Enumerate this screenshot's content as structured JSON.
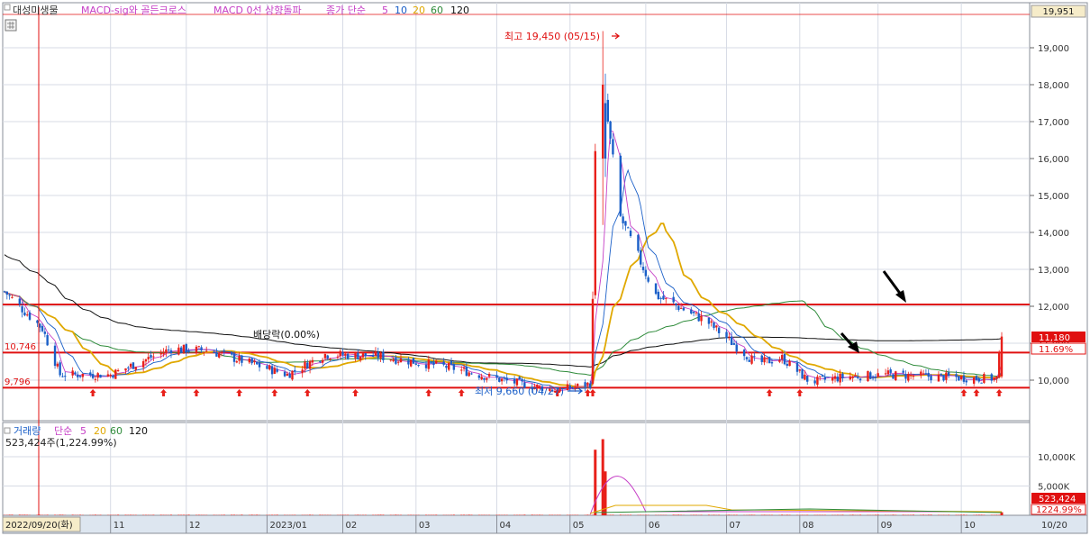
{
  "colors": {
    "up": "#e8201a",
    "down": "#1a5fc8",
    "ma5": "#c63fc6",
    "ma20": "#e0a800",
    "ma60": "#2e8b3a",
    "ma120": "#111111",
    "level": "#e01010",
    "grid": "#d7dbe5",
    "axis_bg": "#dde6f0"
  },
  "price_panel": {
    "legend": {
      "name": "대성미생물",
      "indicator1": "MACD-sig와 골든크로스",
      "indicator2": "MACD 0선 상향돌파",
      "ma_title": "종가 단순",
      "ma_periods": [
        "5",
        "10",
        "20",
        "60",
        "120"
      ]
    },
    "y_ticks": [
      "19,000",
      "18,000",
      "17,000",
      "16,000",
      "15,000",
      "14,000",
      "13,000",
      "12,000",
      "11,000",
      "10,000"
    ],
    "current_badge": "19,951",
    "last_price_badge": "11,180",
    "last_pct_badge": "11.69%",
    "level_labels": [
      "10,746",
      "9,796"
    ],
    "annotations": {
      "high": "최고 19,450 (05/15)",
      "low": "최저 9,660 (04/27)",
      "dividend": "배당락(0.00%)"
    }
  },
  "volume_panel": {
    "legend": {
      "title": "거래량",
      "ma_title": "단순",
      "ma_periods": [
        "5",
        "20",
        "60",
        "120"
      ]
    },
    "info": "523,424주(1,224.99%)",
    "y_ticks": [
      "10,000K",
      "5,000K"
    ],
    "last_badge": "523,424",
    "pct_badge": "1224.99%"
  },
  "x_axis": {
    "start_label": "2022/09/20(화)",
    "month_labels": [
      "11",
      "12",
      "2023/01",
      "02",
      "03",
      "04",
      "05",
      "06",
      "07",
      "08",
      "09",
      "10",
      "10/20"
    ]
  },
  "chart_data": {
    "type": "candlestick",
    "title": "대성미생물",
    "x": "2022/09/20 – 2023/10/20, daily",
    "ylim": [
      9200,
      19800
    ],
    "horizontal_levels": [
      12050,
      10746,
      9796
    ],
    "high": {
      "date": "2023/05/15",
      "value": 19450
    },
    "low": {
      "date": "2023/04/27",
      "value": 9660
    },
    "last_close": 11180,
    "last_change_pct": 11.69,
    "close_path": [
      {
        "date": "2022-09-20",
        "close": 12400
      },
      {
        "date": "2022-10-05",
        "close": 11400
      },
      {
        "date": "2022-10-12",
        "close": 10150
      },
      {
        "date": "2022-11-01",
        "close": 10150
      },
      {
        "date": "2022-11-25",
        "close": 10850
      },
      {
        "date": "2022-12-10",
        "close": 10800
      },
      {
        "date": "2023-01-10",
        "close": 10150
      },
      {
        "date": "2023-01-25",
        "close": 10700
      },
      {
        "date": "2023-02-15",
        "close": 10650
      },
      {
        "date": "2023-03-15",
        "close": 10350
      },
      {
        "date": "2023-04-05",
        "close": 10000
      },
      {
        "date": "2023-04-27",
        "close": 9720
      },
      {
        "date": "2023-05-10",
        "close": 9900
      },
      {
        "date": "2023-05-12",
        "close": 16200
      },
      {
        "date": "2023-05-15",
        "close": 18000
      },
      {
        "date": "2023-05-22",
        "close": 14400
      },
      {
        "date": "2023-06-05",
        "close": 12300
      },
      {
        "date": "2023-06-25",
        "close": 11600
      },
      {
        "date": "2023-07-15",
        "close": 10450
      },
      {
        "date": "2023-07-25",
        "close": 10600
      },
      {
        "date": "2023-08-05",
        "close": 9950
      },
      {
        "date": "2023-08-20",
        "close": 10100
      },
      {
        "date": "2023-09-05",
        "close": 10150
      },
      {
        "date": "2023-10-10",
        "close": 10050
      },
      {
        "date": "2023-10-18",
        "close": 10050
      },
      {
        "date": "2023-10-20",
        "close": 11180
      }
    ],
    "volume_spikes": [
      {
        "date": "2023-05-12",
        "volume_k": 11200
      },
      {
        "date": "2023-05-15",
        "volume_k": 13000
      },
      {
        "date": "2023-05-16",
        "volume_k": 7500
      },
      {
        "date": "2023-10-20",
        "volume_k": 523
      }
    ],
    "volume_ylim": [
      0,
      13500
    ]
  }
}
